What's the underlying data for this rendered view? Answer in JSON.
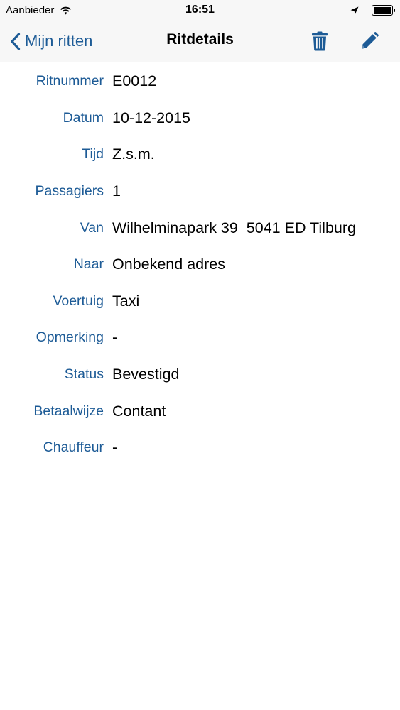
{
  "status_bar": {
    "carrier": "Aanbieder",
    "time": "16:51",
    "battery_level": 1.0
  },
  "nav": {
    "back_label": "Mijn ritten",
    "title": "Ritdetails"
  },
  "details": [
    {
      "label": "Ritnummer",
      "value": "E0012"
    },
    {
      "label": "Datum",
      "value": "10-12-2015"
    },
    {
      "label": "Tijd",
      "value": "Z.s.m."
    },
    {
      "label": "Passagiers",
      "value": "1"
    },
    {
      "label": "Van",
      "value": "Wilhelminapark 39  5041 ED Tilburg"
    },
    {
      "label": "Naar",
      "value": "Onbekend adres"
    },
    {
      "label": "Voertuig",
      "value": "Taxi"
    },
    {
      "label": "Opmerking",
      "value": "-"
    },
    {
      "label": "Status",
      "value": "Bevestigd"
    },
    {
      "label": "Betaalwijze",
      "value": "Contant"
    },
    {
      "label": "Chauffeur",
      "value": "-"
    }
  ],
  "icons": {
    "back": "chevron-left-icon",
    "trash": "trash-icon",
    "edit": "pencil-icon",
    "wifi": "wifi-icon",
    "location": "location-arrow-icon",
    "battery": "battery-icon"
  },
  "colors": {
    "accent": "#1d5b96",
    "bar_background": "#f7f7f7",
    "text": "#000000"
  }
}
